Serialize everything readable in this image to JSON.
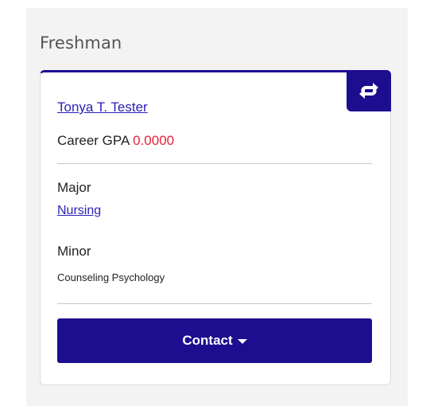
{
  "panel": {
    "title": "Freshman"
  },
  "card": {
    "student_name": "Tonya T. Tester",
    "gpa_label": "Career GPA",
    "gpa_value": "0.0000",
    "major_label": "Major",
    "major_value": "Nursing",
    "minor_label": "Minor",
    "minor_value": "Counseling Psychology",
    "swap_icon": "swap-arrows-icon",
    "contact_label": "Contact"
  },
  "colors": {
    "brand": "#1d0d8f",
    "link": "#2a1fb6",
    "gpa_alert": "#e0243a"
  }
}
